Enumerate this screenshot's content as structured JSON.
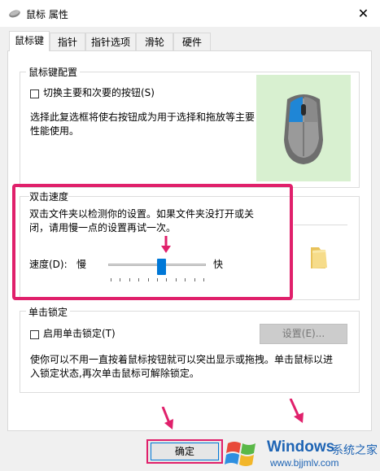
{
  "window": {
    "title": "鼠标 属性",
    "close_symbol": "✕"
  },
  "tabs": [
    {
      "label": "鼠标键",
      "active": true
    },
    {
      "label": "指针"
    },
    {
      "label": "指针选项"
    },
    {
      "label": "滑轮"
    },
    {
      "label": "硬件"
    }
  ],
  "button_config": {
    "group_title": "鼠标键配置",
    "switch_checkbox_label": "切换主要和次要的按钮(S)",
    "switch_checked": false,
    "description_line1": "选择此复选框将使右按钮成为用于选择和拖放等主要",
    "description_line2": "性能使用。"
  },
  "double_click": {
    "group_title": "双击速度",
    "description_line1": "双击文件夹以检测你的设置。如果文件夹没打开或关",
    "description_line2": "闭，请用慢一点的设置再试一次。",
    "speed_label": "速度(D):",
    "slow_label": "慢",
    "fast_label": "快",
    "speed_value": 0.55
  },
  "click_lock": {
    "group_title": "单击锁定",
    "checkbox_label": "启用单击锁定(T)",
    "checked": false,
    "settings_button": "设置(E)...",
    "description_line1": "使你可以不用一直按着鼠标按钮就可以突出显示或拖拽。单击鼠标以进",
    "description_line2": "入锁定状态,再次单击鼠标可解除锁定。"
  },
  "footer": {
    "ok_button": "确定"
  },
  "watermark": {
    "brand": "Windows",
    "brand_cn": "系统之家",
    "url": "www.bjjmlv.com"
  },
  "colors": {
    "highlight": "#e0206b",
    "accent": "#0078d7",
    "mouse_bg": "#d8f0d0"
  }
}
